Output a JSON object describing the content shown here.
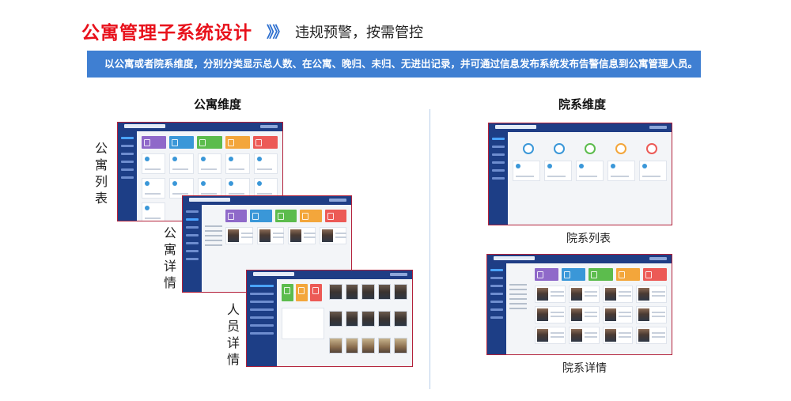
{
  "header": {
    "title": "公寓管理子系统设计",
    "chevrons": "》》",
    "subtitle": "违规预警，按需管控"
  },
  "banner": {
    "text": "以公寓或者院系维度，分别分类显示总人数、在公寓、晚归、未归、无进出记录，并可通过信息发布系统发布告警信息到公寓管理人员。"
  },
  "left": {
    "title": "公寓维度",
    "labels": {
      "apartment_list": "公寓列表",
      "apartment_detail": "公寓详情",
      "person_detail": "人员详情"
    }
  },
  "right": {
    "title": "院系维度",
    "labels": {
      "dept_list": "院系列表",
      "dept_detail": "院系详情"
    }
  },
  "colors": {
    "title_red": "#e8111b",
    "banner_blue": "#3f7fd2",
    "app_navy": "#1f3d85",
    "frame_red": "#b3213a",
    "tile_purple": "#8f69c9",
    "tile_blue": "#3a97d8",
    "tile_green": "#5cbc4d",
    "tile_orange": "#f3a63b",
    "tile_red": "#ec5a56"
  }
}
